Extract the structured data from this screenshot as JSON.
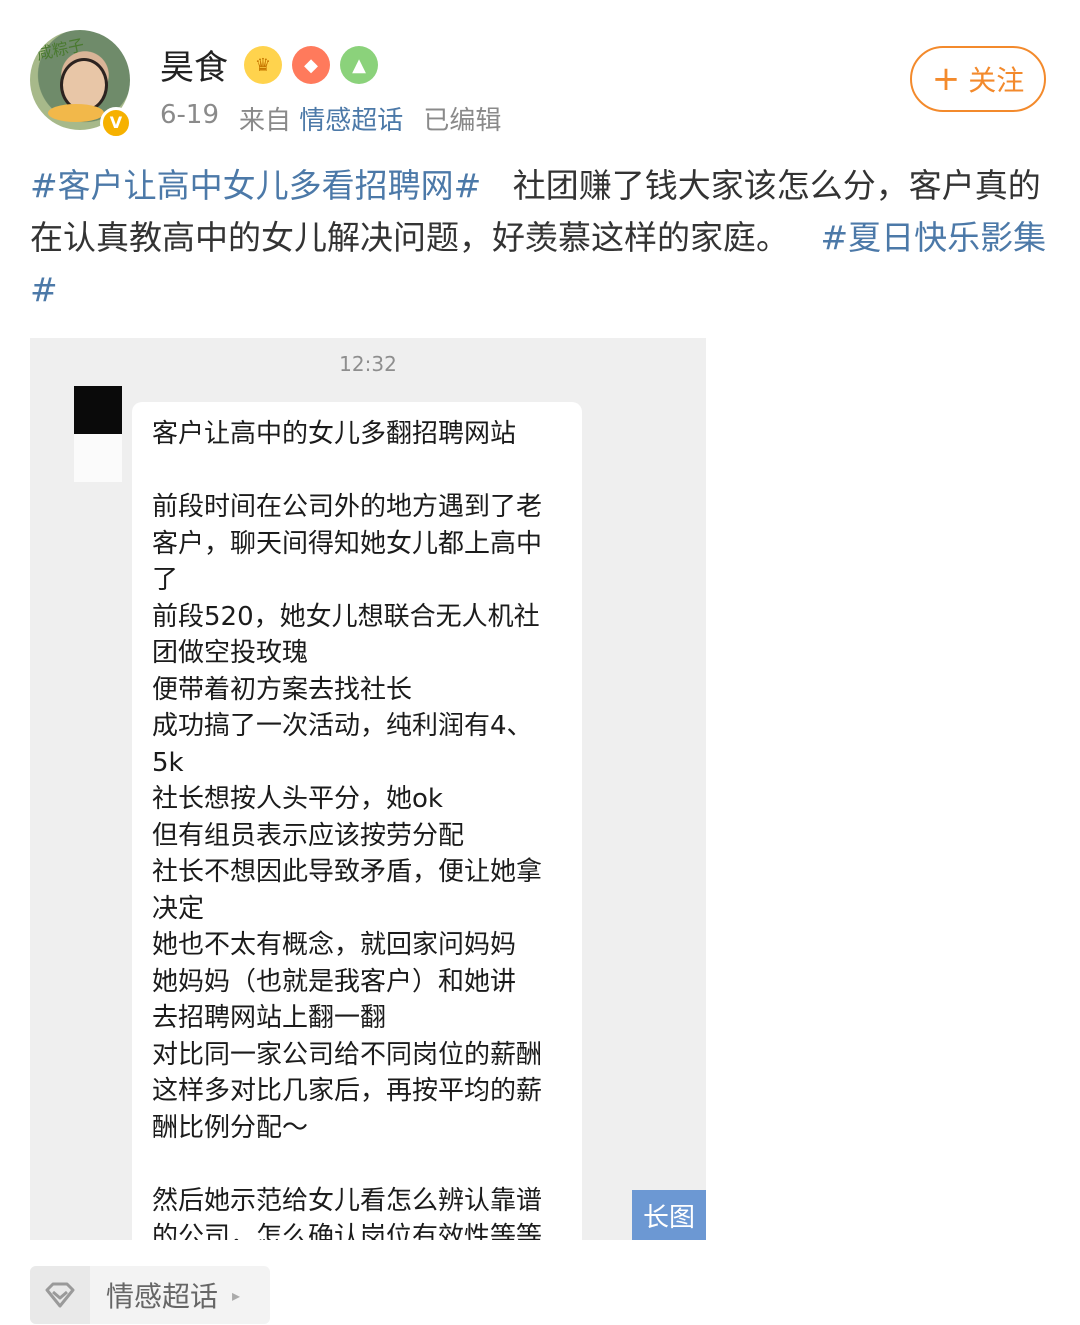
{
  "post": {
    "author": {
      "name": "昊食",
      "avatar_text": "咸粽子"
    },
    "meta": {
      "date": "6-19",
      "source_prefix": "来自",
      "source": "情感超话",
      "status": "已编辑"
    },
    "follow_button": {
      "plus": "+",
      "label": "关注"
    },
    "content": {
      "topic1": "#客户让高中女儿多看招聘网#",
      "body": "社团赚了钱大家该怎么分，客户真的在认真教高中的女儿解决问题，好羡慕这样的家庭。",
      "topic2": "#夏日快乐影集#"
    }
  },
  "chat_image": {
    "time": "12:32",
    "lines": [
      "客户让高中的女儿多翻招聘网站",
      "",
      "前段时间在公司外的地方遇到了老",
      "客户，聊天间得知她女儿都上高中",
      "了",
      "前段520，她女儿想联合无人机社",
      "团做空投玫瑰",
      "便带着初方案去找社长",
      "成功搞了一次活动，纯利润有4、",
      "5k",
      "社长想按人头平分，她ok",
      "但有组员表示应该按劳分配",
      "社长不想因此导致矛盾，便让她拿",
      "决定",
      "她也不太有概念，就回家问妈妈",
      "她妈妈（也就是我客户）和她讲",
      "去招聘网站上翻一翻",
      "对比同一家公司给不同岗位的薪酬",
      "这样多对比几家后，再按平均的薪",
      "酬比例分配～",
      "",
      "然后她示范给女儿看怎么辨认靠谱",
      "的公司，怎么确认岗位有效性等等"
    ],
    "tag": "长图"
  },
  "footer": {
    "label": "情感超话",
    "arrow": "▸"
  }
}
